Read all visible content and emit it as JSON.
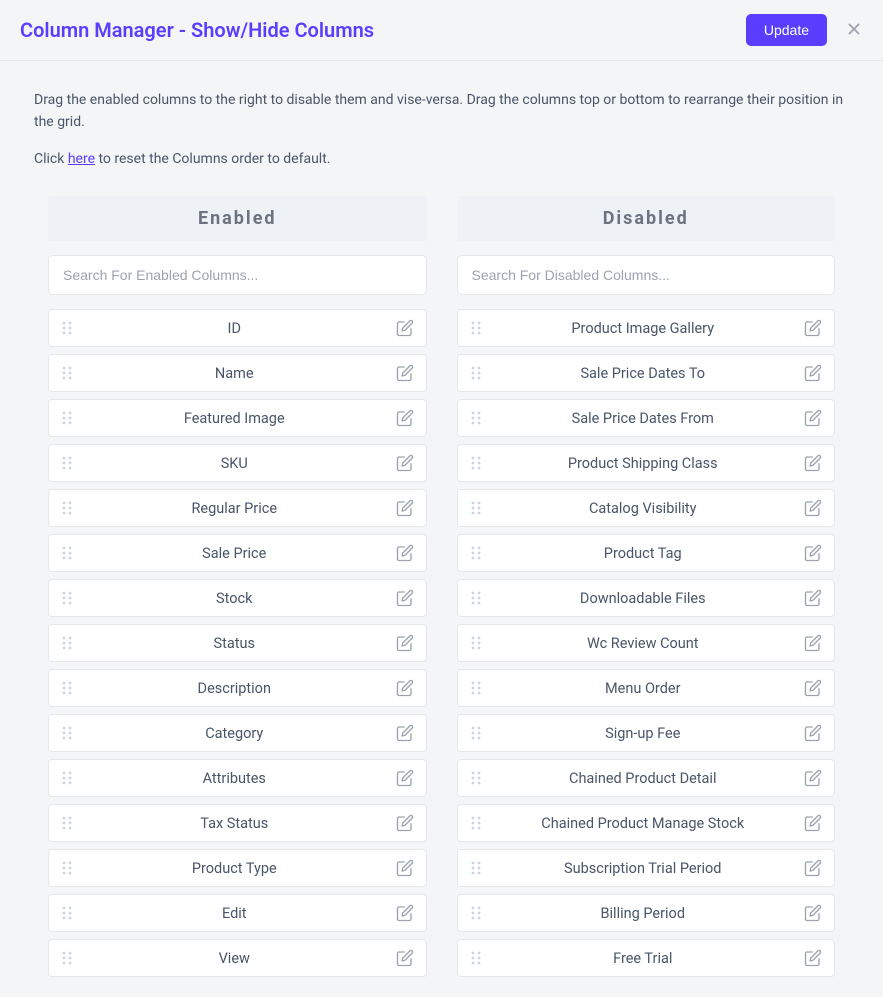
{
  "header": {
    "title": "Column Manager - Show/Hide Columns",
    "update_label": "Update"
  },
  "intro": {
    "line1": "Drag the enabled columns to the right to disable them and vise-versa. Drag the columns top or bottom to rearrange their position in the grid.",
    "line2_pre": "Click ",
    "line2_link": "here",
    "line2_post": " to reset the Columns order to default."
  },
  "enabled": {
    "heading": "Enabled",
    "search_placeholder": "Search For Enabled Columns...",
    "items": [
      {
        "label": "ID"
      },
      {
        "label": "Name"
      },
      {
        "label": "Featured Image"
      },
      {
        "label": "SKU"
      },
      {
        "label": "Regular Price"
      },
      {
        "label": "Sale Price"
      },
      {
        "label": "Stock"
      },
      {
        "label": "Status"
      },
      {
        "label": "Description"
      },
      {
        "label": "Category"
      },
      {
        "label": "Attributes"
      },
      {
        "label": "Tax Status"
      },
      {
        "label": "Product Type"
      },
      {
        "label": "Edit"
      },
      {
        "label": "View"
      }
    ]
  },
  "disabled": {
    "heading": "Disabled",
    "search_placeholder": "Search For Disabled Columns...",
    "items": [
      {
        "label": "Product Image Gallery"
      },
      {
        "label": "Sale Price Dates To"
      },
      {
        "label": "Sale Price Dates From"
      },
      {
        "label": "Product Shipping Class"
      },
      {
        "label": "Catalog Visibility"
      },
      {
        "label": "Product Tag"
      },
      {
        "label": "Downloadable Files"
      },
      {
        "label": "Wc Review Count"
      },
      {
        "label": "Menu Order"
      },
      {
        "label": "Sign-up Fee"
      },
      {
        "label": "Chained Product Detail"
      },
      {
        "label": "Chained Product Manage Stock"
      },
      {
        "label": "Subscription Trial Period"
      },
      {
        "label": "Billing Period"
      },
      {
        "label": "Free Trial"
      }
    ]
  }
}
